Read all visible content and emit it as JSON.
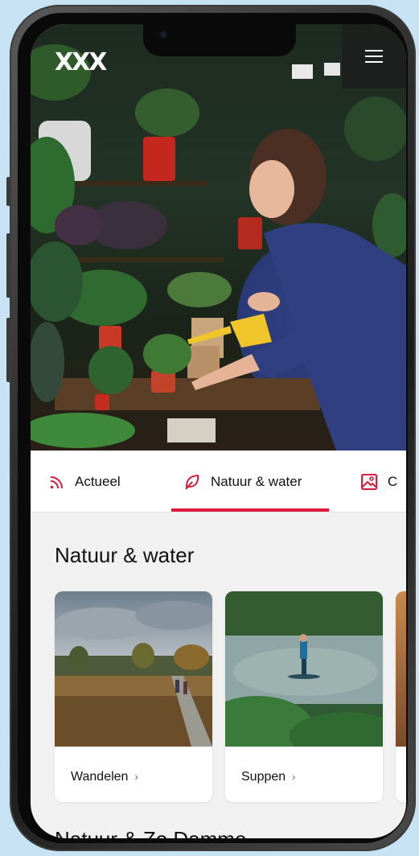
{
  "brand": {
    "logo_text": "XXX"
  },
  "header": {
    "menu_icon": "hamburger-icon"
  },
  "tabs": [
    {
      "label": "Actueel",
      "icon": "rss-icon",
      "active": false
    },
    {
      "label": "Natuur & water",
      "icon": "leaf-icon",
      "active": true
    },
    {
      "label": "C",
      "icon": "image-icon",
      "active": false
    }
  ],
  "section": {
    "title": "Natuur & water"
  },
  "cards": [
    {
      "label": "Wandelen",
      "chevron": "›"
    },
    {
      "label": "Suppen",
      "chevron": "›"
    }
  ],
  "next_section": {
    "title": "Natuur & Zo Damme"
  },
  "colors": {
    "accent": "#e0183b",
    "background": "#c7e3f3"
  }
}
